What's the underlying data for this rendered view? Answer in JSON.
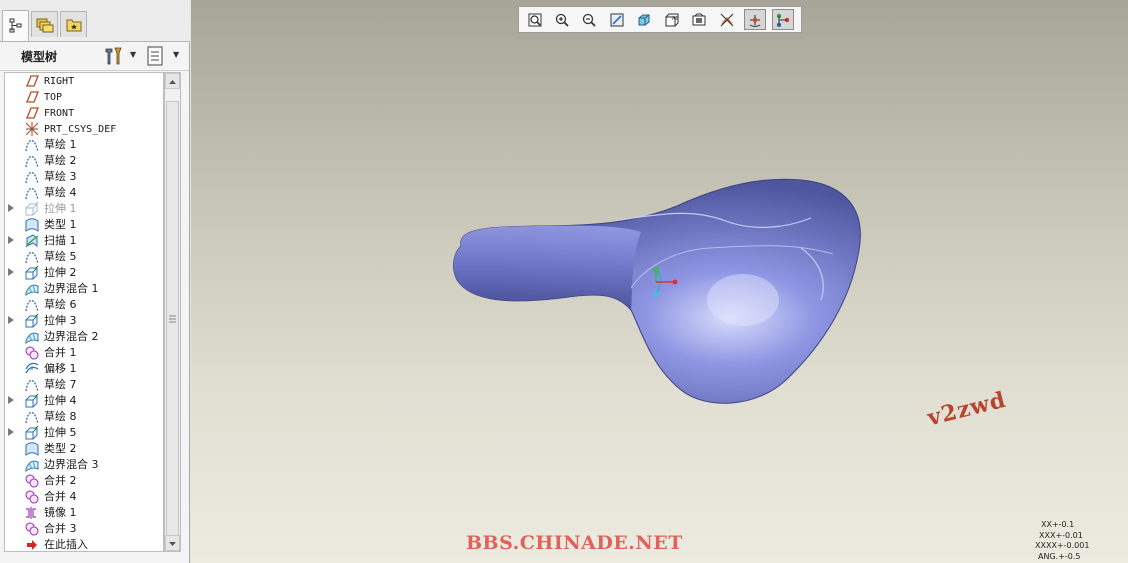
{
  "panel": {
    "tabs": [
      {
        "name": "model-tree-tab",
        "active": true
      },
      {
        "name": "folder-browser-tab",
        "active": false
      },
      {
        "name": "favorites-tab",
        "active": false
      }
    ],
    "title": "模型树"
  },
  "tree": {
    "items": [
      {
        "label": "RIGHT",
        "icon": "datum-plane-icon",
        "expandable": false
      },
      {
        "label": "TOP",
        "icon": "datum-plane-icon",
        "expandable": false
      },
      {
        "label": "FRONT",
        "icon": "datum-plane-icon",
        "expandable": false
      },
      {
        "label": "PRT_CSYS_DEF",
        "icon": "coordinate-system-icon",
        "expandable": false
      },
      {
        "label": "草绘 1",
        "icon": "sketch-icon",
        "expandable": false
      },
      {
        "label": "草绘 2",
        "icon": "sketch-icon",
        "expandable": false
      },
      {
        "label": "草绘 3",
        "icon": "sketch-icon",
        "expandable": false
      },
      {
        "label": "草绘 4",
        "icon": "sketch-icon",
        "expandable": false
      },
      {
        "label": "拉伸 1",
        "icon": "extrude-icon",
        "expandable": true,
        "suppressed": true
      },
      {
        "label": "类型 1",
        "icon": "style-surface-icon",
        "expandable": false
      },
      {
        "label": "扫描 1",
        "icon": "sweep-icon",
        "expandable": true
      },
      {
        "label": "草绘 5",
        "icon": "sketch-icon",
        "expandable": false
      },
      {
        "label": "拉伸 2",
        "icon": "extrude-icon",
        "expandable": true
      },
      {
        "label": "边界混合 1",
        "icon": "boundary-blend-icon",
        "expandable": false
      },
      {
        "label": "草绘 6",
        "icon": "sketch-icon",
        "expandable": false
      },
      {
        "label": "拉伸 3",
        "icon": "extrude-icon",
        "expandable": true
      },
      {
        "label": "边界混合 2",
        "icon": "boundary-blend-icon",
        "expandable": false
      },
      {
        "label": "合并 1",
        "icon": "merge-icon",
        "expandable": false
      },
      {
        "label": "偏移 1",
        "icon": "offset-icon",
        "expandable": false
      },
      {
        "label": "草绘 7",
        "icon": "sketch-icon",
        "expandable": false
      },
      {
        "label": "拉伸 4",
        "icon": "extrude-icon",
        "expandable": true
      },
      {
        "label": "草绘 8",
        "icon": "sketch-icon",
        "expandable": false
      },
      {
        "label": "拉伸 5",
        "icon": "extrude-icon",
        "expandable": true
      },
      {
        "label": "类型 2",
        "icon": "style-surface-icon",
        "expandable": false
      },
      {
        "label": "边界混合 3",
        "icon": "boundary-blend-icon",
        "expandable": false
      },
      {
        "label": "合并 2",
        "icon": "merge-icon",
        "expandable": false
      },
      {
        "label": "合并 4",
        "icon": "merge-icon",
        "expandable": false
      },
      {
        "label": "镜像 1",
        "icon": "mirror-icon",
        "expandable": false
      },
      {
        "label": "合并 3",
        "icon": "merge-icon",
        "expandable": false
      },
      {
        "label": "在此插入",
        "icon": "insert-here-arrow-icon",
        "expandable": false
      }
    ]
  },
  "toolbar": {
    "buttons": [
      {
        "name": "refit-zoom-button",
        "active": false
      },
      {
        "name": "zoom-in-button",
        "active": false
      },
      {
        "name": "zoom-out-button",
        "active": false
      },
      {
        "name": "repaint-button",
        "active": false
      },
      {
        "name": "display-style-button",
        "active": false
      },
      {
        "name": "saved-views-button",
        "active": false
      },
      {
        "name": "view-manager-button",
        "active": false
      },
      {
        "name": "datum-display-button",
        "active": false
      },
      {
        "name": "spin-center-button",
        "active": true
      },
      {
        "name": "selection-filter-button",
        "active": true
      }
    ]
  },
  "viewport": {
    "watermark": "v2zwd",
    "site_text": "BBS.CHINADE.NET",
    "tolerance": [
      "XX+-0.1",
      "XXX+-0.01",
      "XXXX+-0.001",
      "ANG.+-0.5"
    ]
  },
  "colors": {
    "model": "#6f76c9",
    "watermark": "#b8432e",
    "site_text": "#e0625a"
  }
}
